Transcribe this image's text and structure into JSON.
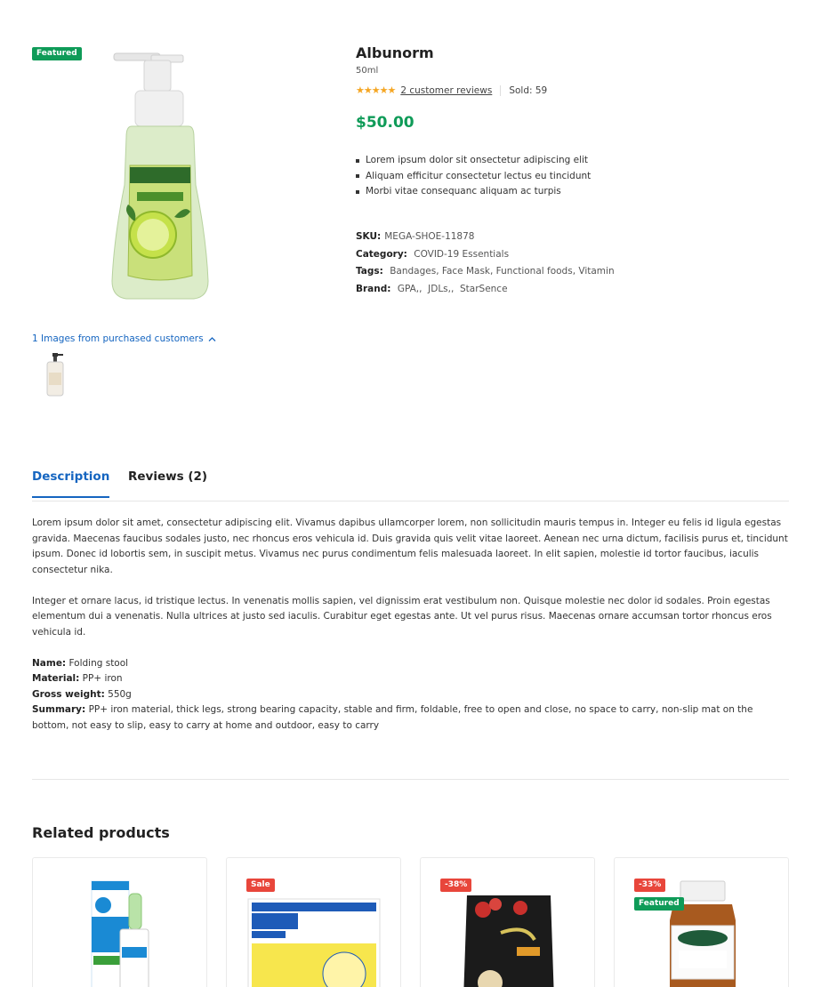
{
  "product": {
    "badge": "Featured",
    "title": "Albunorm",
    "variant": "50ml",
    "rating_stars": "★★★★★",
    "reviews_link": "2 customer reviews",
    "sold": "Sold: 59",
    "price": "$50.00",
    "bullets": [
      "Lorem ipsum dolor sit onsectetur adipiscing elit",
      "Aliquam efficitur consectetur lectus eu tincidunt",
      "Morbi vitae consequanc aliquam ac turpis"
    ],
    "meta": {
      "sku_label": "SKU:",
      "sku": "MEGA-SHOE-11878",
      "category_label": "Category:",
      "category": "COVID-19 Essentials",
      "tags_label": "Tags:",
      "tags": "Bandages, Face Mask, Functional foods, Vitamin",
      "brand_label": "Brand:",
      "brand": "GPA,,  JDLs,,  StarSence"
    }
  },
  "purchased": {
    "link": "1 Images from purchased customers",
    "chevron": "^"
  },
  "tabs": [
    {
      "label": "Description"
    },
    {
      "label": "Reviews (2)"
    }
  ],
  "description": {
    "p1": "Lorem ipsum dolor sit amet, consectetur adipiscing elit. Vivamus dapibus ullamcorper lorem, non sollicitudin mauris tempus in. Integer eu felis id ligula egestas gravida. Maecenas faucibus sodales justo, nec rhoncus eros vehicula id. Duis gravida quis velit vitae laoreet. Aenean nec urna dictum, facilisis purus et, tincidunt ipsum. Donec id lobortis sem, in suscipit metus. Vivamus nec purus condimentum felis malesuada laoreet. In elit sapien, molestie id tortor faucibus, iaculis consectetur nika.",
    "p2": "Integer et ornare lacus, id tristique lectus. In venenatis mollis sapien, vel dignissim erat vestibulum non. Quisque molestie nec dolor id sodales. Proin egestas elementum dui a venenatis. Nulla ultrices at justo sed iaculis. Curabitur eget egestas ante. Ut vel purus risus. Maecenas ornare accumsan tortor rhoncus eros vehicula id.",
    "specs": [
      {
        "k": "Name:",
        "v": " Folding stool"
      },
      {
        "k": "Material:",
        "v": " PP+ iron"
      },
      {
        "k": "Gross weight:",
        "v": " 550g"
      },
      {
        "k": "Summary:",
        "v": " PP+ iron material, thick legs, strong bearing capacity, stable and firm, foldable, free to open and close, no space to carry, non-slip mat on the bottom, not easy to slip, easy to carry at home and outdoor, easy to carry"
      }
    ]
  },
  "related": {
    "title": "Related products",
    "items": [
      {
        "badges": [],
        "image": "nasal-spray-box"
      },
      {
        "badges": [
          "Sale"
        ],
        "image": "bisol-pastilles-box"
      },
      {
        "badges": [
          "-38%"
        ],
        "image": "fruit-snack-pouch"
      },
      {
        "badges": [
          "-33%",
          "Featured"
        ],
        "image": "ginkgo-bottle"
      }
    ]
  },
  "colors": {
    "accent_blue": "#1565c0",
    "price_green": "#0f9b58",
    "featured_green": "#0f9b58",
    "sale_red": "#e8463b",
    "star_gold": "#f5a623"
  }
}
